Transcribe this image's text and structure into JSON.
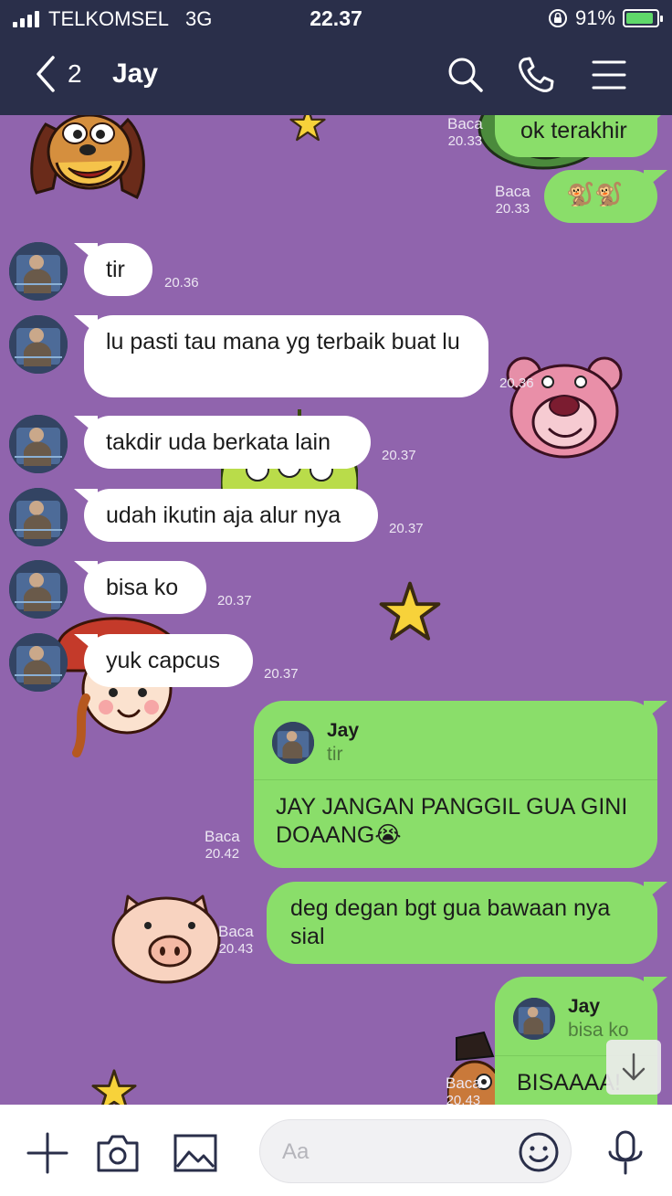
{
  "status_bar": {
    "carrier": "TELKOMSEL",
    "network": "3G",
    "time": "22.37",
    "battery": "91%",
    "battery_level": 0.91
  },
  "header": {
    "back_count": "2",
    "title": "Jay"
  },
  "messages": [
    {
      "dir": "out",
      "text": "ok terakhir",
      "status": "Baca",
      "time": "20.33"
    },
    {
      "dir": "out",
      "text": "🐒🐒",
      "status": "Baca",
      "time": "20.33"
    },
    {
      "dir": "in",
      "text": "tir",
      "time": "20.36"
    },
    {
      "dir": "in",
      "text": "lu pasti tau mana yg terbaik buat lu",
      "time": "20.36"
    },
    {
      "dir": "in",
      "text": "takdir uda berkata lain",
      "time": "20.37"
    },
    {
      "dir": "in",
      "text": "udah ikutin aja alur nya",
      "time": "20.37"
    },
    {
      "dir": "in",
      "text": "bisa ko",
      "time": "20.37"
    },
    {
      "dir": "in",
      "text": "yuk capcus",
      "time": "20.37"
    },
    {
      "dir": "out",
      "reply_name": "Jay",
      "reply_text": "tir",
      "text": "JAY JANGAN PANGGIL GUA GINI DOAANG😭",
      "status": "Baca",
      "time": "20.42"
    },
    {
      "dir": "out",
      "text": "deg degan bgt gua bawaan nya sial",
      "status": "Baca",
      "time": "20.43"
    },
    {
      "dir": "out",
      "reply_name": "Jay",
      "reply_text": "bisa ko",
      "text": "BISAAAA!",
      "status": "Baca",
      "time": "20.43"
    }
  ],
  "input": {
    "placeholder": "Aa"
  },
  "icons": {
    "header": [
      "back-chevron-icon",
      "search-icon",
      "phone-icon",
      "menu-icon"
    ],
    "bottom": [
      "plus-icon",
      "camera-icon",
      "image-icon",
      "emoji-icon",
      "microphone-icon"
    ],
    "scroll": "arrow-down-icon"
  },
  "colors": {
    "header_bg": "#2a2f4a",
    "chat_bg": "#9064ad",
    "bubble_out": "#8ade6a",
    "bubble_in": "#ffffff"
  }
}
